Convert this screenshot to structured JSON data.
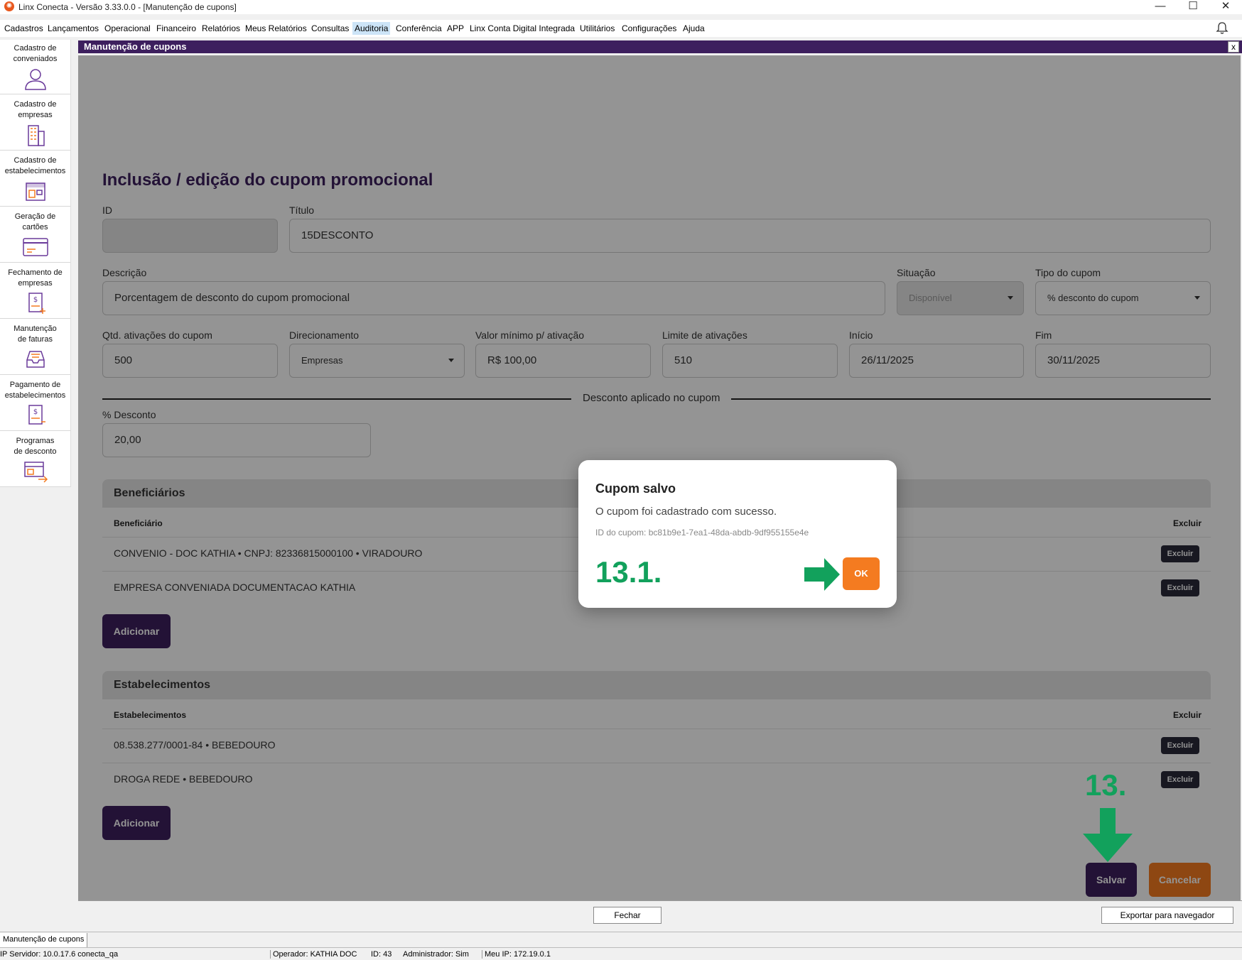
{
  "window": {
    "title": "Linx Conecta - Versão 3.33.0.0 - [Manutenção de cupons]",
    "minimize": "—",
    "maximize": "☐",
    "close": "✕"
  },
  "menu": [
    "Cadastros",
    "Lançamentos",
    "Operacional",
    "Financeiro",
    "Relatórios",
    "Meus Relatórios",
    "Consultas",
    "Auditoria",
    "Conferência",
    "APP",
    "Linx Conta Digital Integrada",
    "Utilitários",
    "Configurações",
    "Ajuda"
  ],
  "menu_active": "Auditoria",
  "sidebar": {
    "items": [
      {
        "label1": "Cadastro de",
        "label2": "conveniados",
        "icon": "person-icon"
      },
      {
        "label1": "Cadastro de",
        "label2": "empresas",
        "icon": "building-icon"
      },
      {
        "label1": "Cadastro de",
        "label2": "estabelecimentos",
        "icon": "store-icon"
      },
      {
        "label1": "Geração de",
        "label2": "cartões",
        "icon": "card-icon"
      },
      {
        "label1": "Fechamento de",
        "label2": "empresas",
        "icon": "invoice-icon"
      },
      {
        "label1": "Manutenção",
        "label2": "de faturas",
        "icon": "inbox-icon"
      },
      {
        "label1": "Pagamento de",
        "label2": "estabelecimentos",
        "icon": "payment-icon"
      },
      {
        "label1": "Programas",
        "label2": "de desconto",
        "icon": "discount-icon"
      }
    ]
  },
  "frame": {
    "title": "Manutenção de cupons",
    "close": "x"
  },
  "form": {
    "heading": "Inclusão / edição do cupom promocional",
    "id_label": "ID",
    "id_value": "",
    "titulo_label": "Título",
    "titulo_value": "15DESCONTO",
    "descricao_label": "Descrição",
    "descricao_value": "Porcentagem de desconto do cupom promocional",
    "situacao_label": "Situação",
    "situacao_value": "Disponível",
    "tipo_label": "Tipo do cupom",
    "tipo_value": "% desconto do cupom",
    "qtd_label": "Qtd. ativações do cupom",
    "qtd_value": "500",
    "direcionamento_label": "Direcionamento",
    "direcionamento_value": "Empresas",
    "valor_min_label": "Valor mínimo p/ ativação",
    "valor_min_value": "R$ 100,00",
    "limite_label": "Limite de ativações",
    "limite_value": "510",
    "inicio_label": "Início",
    "inicio_value": "26/11/2025",
    "fim_label": "Fim",
    "fim_value": "30/11/2025",
    "divider_label": "Desconto aplicado no cupom",
    "desconto_label": "% Desconto",
    "desconto_value": "20,00"
  },
  "beneficiarios": {
    "title": "Beneficiários",
    "col_name": "Beneficiário",
    "col_action": "Excluir",
    "rows": [
      {
        "name": "CONVENIO - DOC KATHIA • CNPJ: 82336815000100 • VIRADOURO",
        "action": "Excluir"
      },
      {
        "name": "EMPRESA CONVENIADA DOCUMENTACAO KATHIA",
        "action": "Excluir"
      }
    ],
    "add_label": "Adicionar"
  },
  "estabelecimentos": {
    "title": "Estabelecimentos",
    "col_name": "Estabelecimentos",
    "col_action": "Excluir",
    "rows": [
      {
        "name": "08.538.277/0001-84 • BEBEDOURO",
        "action": "Excluir"
      },
      {
        "name": "DROGA REDE • BEBEDOURO",
        "action": "Excluir"
      }
    ],
    "add_label": "Adicionar"
  },
  "actions": {
    "save": "Salvar",
    "cancel": "Cancelar",
    "step_label": "13."
  },
  "modal": {
    "title": "Cupom salvo",
    "message": "O cupom foi cadastrado com sucesso.",
    "coupon_id": "ID do cupom: bc81b9e1-7ea1-48da-abdb-9df955155e4e",
    "ok": "OK",
    "step_label": "13.1."
  },
  "bottom": {
    "close": "Fechar",
    "export": "Exportar para navegador"
  },
  "tabbar": {
    "tab": "Manutenção de cupons"
  },
  "status": {
    "server": "IP Servidor: 10.0.17.6 conecta_qa",
    "operator": "Operador: KATHIA DOC",
    "id": "ID: 43",
    "admin": "Administrador: Sim",
    "my_ip": "Meu IP: 172.19.0.1"
  },
  "colors": {
    "brand_purple": "#3d1f5e",
    "accent_orange": "#f47b20",
    "step_green": "#12a15c"
  }
}
